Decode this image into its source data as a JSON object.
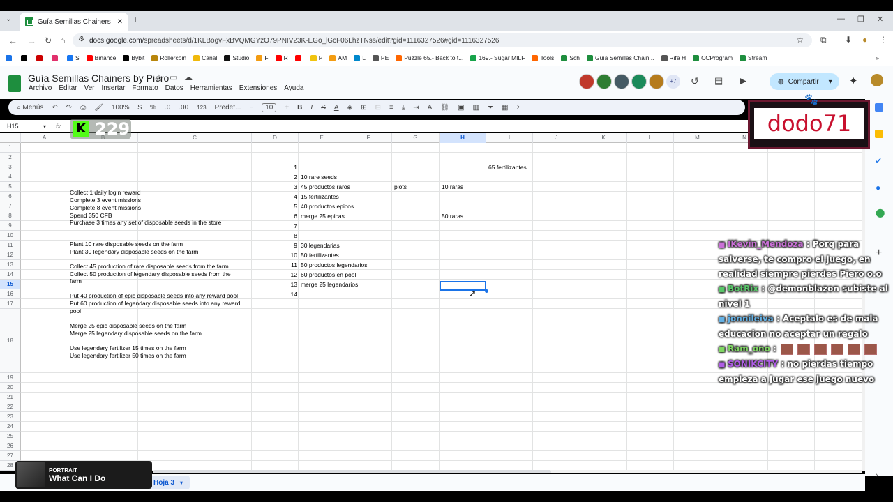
{
  "browser": {
    "tab_title": "Guía Semillas Chainers by Piero",
    "url_prefix": "docs.google.com",
    "url_rest": "/spreadsheets/d/1KLBogvFxBVQMGYzO79PNIV23K-EGo_lGcF06LhzTNss/edit?gid=1116327526#gid=1116327526",
    "bookmarks": [
      "",
      "",
      "",
      "",
      "S",
      "Binance",
      "Bybit",
      "Rollercoin",
      "Canal",
      "Studio",
      "F",
      "R",
      "",
      "P",
      "AM",
      "L",
      "PE",
      "Puzzle 65.- Back to t...",
      "169.- Sugar MILF",
      "Tools",
      "Sch",
      "Guía Semillas Chain...",
      "Rifa H",
      "CCProgram",
      "Stream"
    ]
  },
  "sheets": {
    "title": "Guía Semillas Chainers by Piero",
    "menu": [
      "Archivo",
      "Editar",
      "Ver",
      "Insertar",
      "Formato",
      "Datos",
      "Herramientas",
      "Extensiones",
      "Ayuda"
    ],
    "share_label": "Compartir",
    "extra_users": "+7",
    "toolbar": {
      "menus": "Menús",
      "zoom": "100%",
      "currency": "$",
      "percent": "%",
      "dec_less": ".0",
      "dec_more": ".00",
      "number_format": "123",
      "font": "Predet...",
      "font_size": "10"
    },
    "name_box": "H15",
    "columns": [
      "A",
      "B",
      "C",
      "D",
      "E",
      "F",
      "G",
      "H",
      "I",
      "J",
      "K",
      "L",
      "M",
      "N",
      "O",
      "P"
    ],
    "rows": [
      "1",
      "2",
      "3",
      "4",
      "5",
      "6",
      "7",
      "8",
      "9",
      "10",
      "11",
      "12",
      "13",
      "14",
      "15",
      "16",
      "17",
      "18",
      "19",
      "20",
      "21",
      "22",
      "23",
      "24",
      "25",
      "26",
      "27",
      "28"
    ],
    "col_b": [
      "Collect 1 daily login reward",
      "Complete 3 event missions",
      "Complete 8 event missions",
      "Spend 350 CFB",
      "Purchase 3 times any set of disposable seeds in the store",
      "Plant 10 rare disposable seeds on the farm",
      "Plant 30 legendary disposable seeds on the farm",
      "Collect 45 production of rare disposable seeds from the farm",
      "Collect 50 production of legendary disposable seeds from the",
      "farm",
      "Put 40 production of epic disposable seeds into any reward pool",
      "Put 60 production of legendary disposable seeds into any reward",
      "pool",
      "Merge 25 epic disposable seeds on the farm",
      "Merge 25 legendary disposable seeds on the farm",
      "Use legendary fertilizer 15 times on the farm",
      "Use legendary fertilizer 50 times on the farm"
    ],
    "col_d": [
      "1",
      "2",
      "3",
      "4",
      "5",
      "6",
      "7",
      "8",
      "9",
      "10",
      "11",
      "12",
      "13",
      "14"
    ],
    "col_e": [
      "",
      "10 rare seeds",
      "45 productos raros",
      "15 fertilizantes",
      "40 productos epicos",
      "merge 25 epicas",
      "",
      "",
      "30 legendarias",
      "50 fertilizantes",
      "50 productos legendarios",
      "60 productos en pool",
      "merge 25 legendarios",
      ""
    ],
    "g5": "plots",
    "h5": "10 raras",
    "h8": "50 raras",
    "i3": "65 fertilizantes",
    "sheet_tab": "Hoja 3"
  },
  "overlays": {
    "counter": "229",
    "streamer": "dodo71",
    "chat": [
      {
        "user": "IKevin_Mendoza",
        "text": ": Porq para salverse, te compro el juego, en realidad siempre pierdes Piero o.o",
        "color": "#c058d0"
      },
      {
        "user": "BotRix",
        "text": ": @demonblazon subiste al nivel 1",
        "color": "#3dbb4f"
      },
      {
        "user": "jonnileiva",
        "text": ": Aceptalo es de mala educacion no aceptar un regalo",
        "color": "#4aa3df"
      },
      {
        "user": "Ram_ono",
        "text": ":",
        "color": "#6ad04a"
      },
      {
        "user": "SONIKCITY",
        "text": ": no pierdas tiempo empieza a jugar ese juego nuevo",
        "color": "#a040e0"
      }
    ],
    "now_playing_label": "PORTRAIT",
    "now_playing_title": "What Can I Do"
  }
}
